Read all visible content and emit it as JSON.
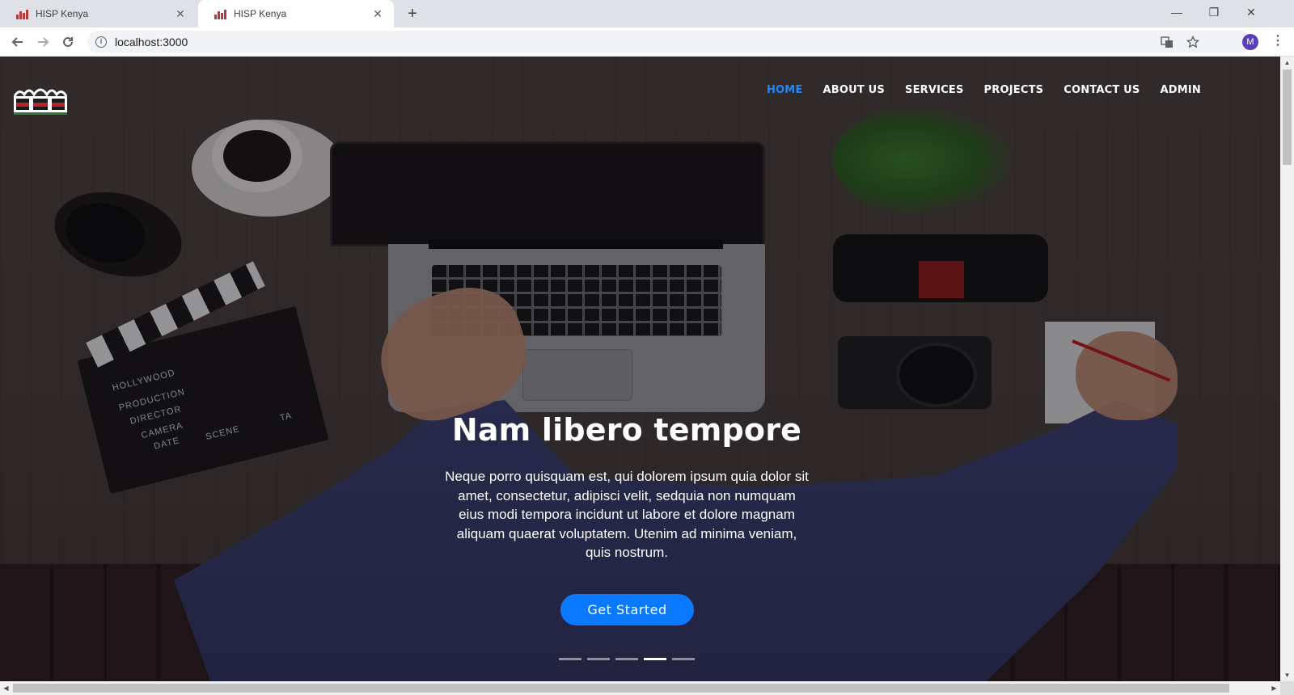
{
  "browser": {
    "tabs": [
      {
        "title": "HISP Kenya",
        "active": false
      },
      {
        "title": "HISP Kenya",
        "active": true
      }
    ],
    "new_tab_icon": "+",
    "close_icon": "✕",
    "address": "localhost:3000",
    "avatar_initial": "M",
    "window_controls": {
      "minimize": "—",
      "restore": "❐",
      "close": "✕"
    }
  },
  "site": {
    "nav": [
      {
        "label": "HOME",
        "active": true
      },
      {
        "label": "ABOUT US",
        "active": false
      },
      {
        "label": "SERVICES",
        "active": false
      },
      {
        "label": "PROJECTS",
        "active": false
      },
      {
        "label": "CONTACT US",
        "active": false
      },
      {
        "label": "ADMIN",
        "active": false
      }
    ],
    "hero": {
      "title": "Nam libero tempore",
      "text": "Neque porro quisquam est, qui dolorem ipsum quia dolor sit amet, consectetur, adipisci velit, sedquia non numquam eius modi tempora incidunt ut labore et dolore magnam aliquam quaerat voluptatem. Utenim ad minima veniam, quis nostrum.",
      "cta_label": "Get Started",
      "slides_total": 5,
      "active_slide": 4
    },
    "clapperboard_text": [
      "HOLLYWOOD",
      "PRODUCTION",
      "DIRECTOR",
      "CAMERA",
      "DATE",
      "SCENE",
      "TA"
    ]
  },
  "colors": {
    "accent": "#1e88ff",
    "cta": "#0b79ff",
    "avatar": "#5b3fb8",
    "tabbar": "#dee1e6"
  }
}
